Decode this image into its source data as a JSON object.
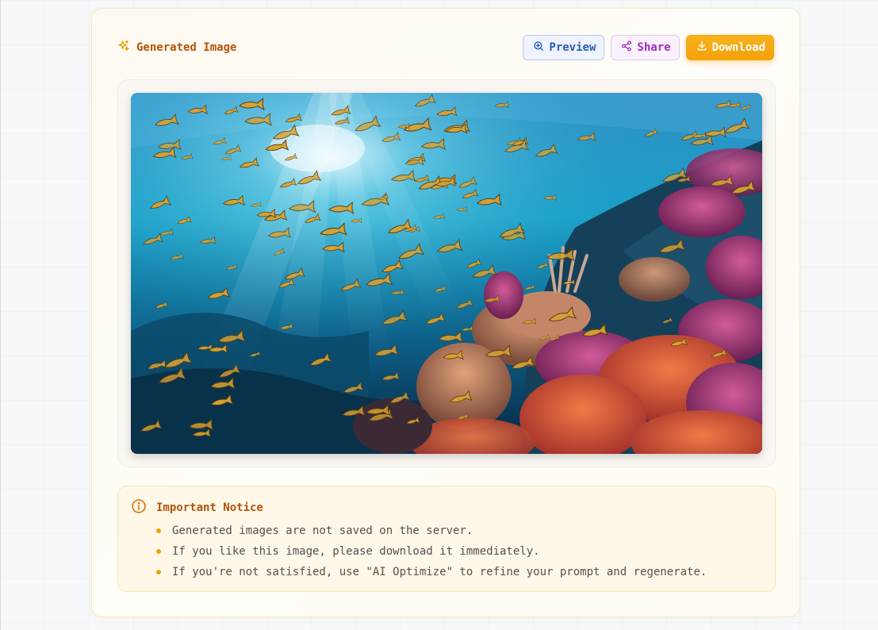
{
  "header": {
    "title": "Generated Image",
    "title_icon": "sparkles-icon"
  },
  "actions": {
    "preview_label": "Preview",
    "preview_icon": "zoom-in-icon",
    "share_label": "Share",
    "share_icon": "share-icon",
    "download_label": "Download",
    "download_icon": "download-icon"
  },
  "image": {
    "alt": "Underwater coral reef with a school of yellow fish and sunlight rays"
  },
  "notice": {
    "title": "Important Notice",
    "icon": "info-icon",
    "items": [
      "Generated images are not saved on the server.",
      "If you like this image, please download it immediately.",
      "If you're not satisfied, use \"AI Optimize\" to refine your prompt and regenerate."
    ]
  },
  "colors": {
    "accent": "#b45309",
    "download": "#f3a10a",
    "preview": "#2b5cb8",
    "share": "#a32cc1"
  }
}
